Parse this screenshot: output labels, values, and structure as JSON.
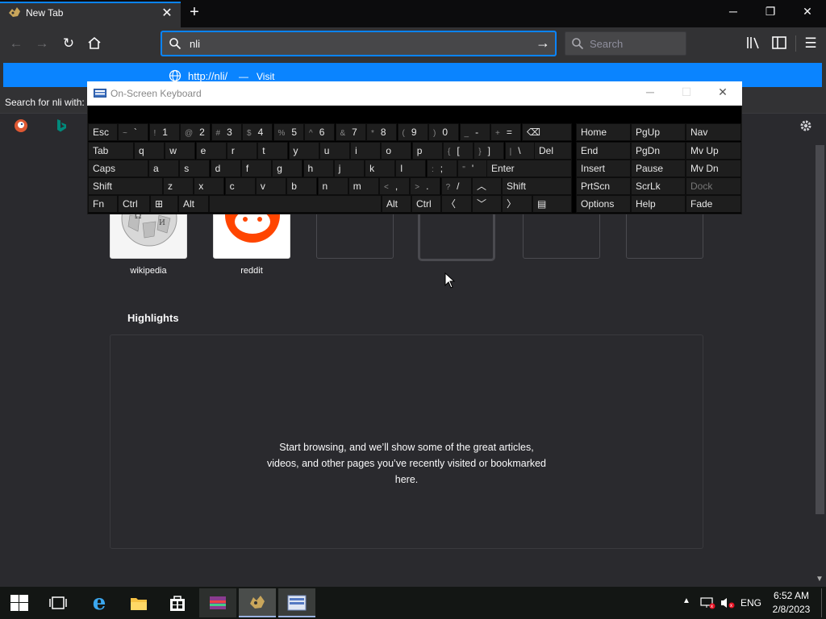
{
  "browser": {
    "tab_title": "New Tab",
    "url_value": "nli",
    "search_placeholder": "Search",
    "dropdown": {
      "suggestion_url": "http://nli/",
      "suggestion_sep": "—",
      "suggestion_action": "Visit",
      "search_for_label": "Search for nli with:"
    }
  },
  "newtab": {
    "tiles": [
      {
        "label": "wikipedia",
        "icon": "wikipedia-globe-icon"
      },
      {
        "label": "reddit",
        "icon": "reddit-alien-icon"
      },
      {
        "label": ""
      },
      {
        "label": ""
      },
      {
        "label": ""
      },
      {
        "label": ""
      }
    ],
    "highlights_title": "Highlights",
    "highlights_message": "Start browsing, and we’ll show some of the great articles, videos, and other pages you’ve recently visited or bookmarked here."
  },
  "osk": {
    "title": "On-Screen Keyboard",
    "keys": {
      "esc": "Esc",
      "tab": "Tab",
      "caps": "Caps",
      "shift_l": "Shift",
      "fn": "Fn",
      "ctrl_l": "Ctrl",
      "alt_l": "Alt",
      "del": "Del",
      "enter": "Enter",
      "shift_r": "Shift",
      "alt_r": "Alt",
      "ctrl_r": "Ctrl",
      "home": "Home",
      "pgup": "PgUp",
      "nav": "Nav",
      "end": "End",
      "pgdn": "PgDn",
      "mvup": "Mv Up",
      "insert": "Insert",
      "pause": "Pause",
      "mvdn": "Mv Dn",
      "prtscn": "PrtScn",
      "scrlk": "ScrLk",
      "dock": "Dock",
      "options": "Options",
      "help": "Help",
      "fade": "Fade",
      "num_row": [
        {
          "top": "~",
          "main": "`"
        },
        {
          "top": "!",
          "main": "1"
        },
        {
          "top": "@",
          "main": "2"
        },
        {
          "top": "#",
          "main": "3"
        },
        {
          "top": "$",
          "main": "4"
        },
        {
          "top": "%",
          "main": "5"
        },
        {
          "top": "^",
          "main": "6"
        },
        {
          "top": "&",
          "main": "7"
        },
        {
          "top": "*",
          "main": "8"
        },
        {
          "top": "(",
          "main": "9"
        },
        {
          "top": ")",
          "main": "0"
        },
        {
          "top": "_",
          "main": "-"
        },
        {
          "top": "+",
          "main": "="
        }
      ],
      "row_q": [
        "q",
        "w",
        "e",
        "r",
        "t",
        "y",
        "u",
        "i",
        "o",
        "p"
      ],
      "row_q_extra": [
        {
          "top": "{",
          "main": "["
        },
        {
          "top": "}",
          "main": "]"
        },
        {
          "top": "|",
          "main": "\\"
        }
      ],
      "row_a": [
        "a",
        "s",
        "d",
        "f",
        "g",
        "h",
        "j",
        "k",
        "l"
      ],
      "row_a_extra": [
        {
          "top": ":",
          "main": ";"
        },
        {
          "top": "\"",
          "main": "'"
        }
      ],
      "row_z": [
        "z",
        "x",
        "c",
        "v",
        "b",
        "n",
        "m"
      ],
      "row_z_extra": [
        {
          "top": "<",
          "main": ","
        },
        {
          "top": ">",
          "main": "."
        },
        {
          "top": "?",
          "main": "/"
        }
      ]
    }
  },
  "taskbar": {
    "time": "6:52 AM",
    "date": "2/8/2023",
    "lang": "ENG"
  },
  "colors": {
    "accent": "#0a84ff",
    "reddit": "#ff4500"
  }
}
